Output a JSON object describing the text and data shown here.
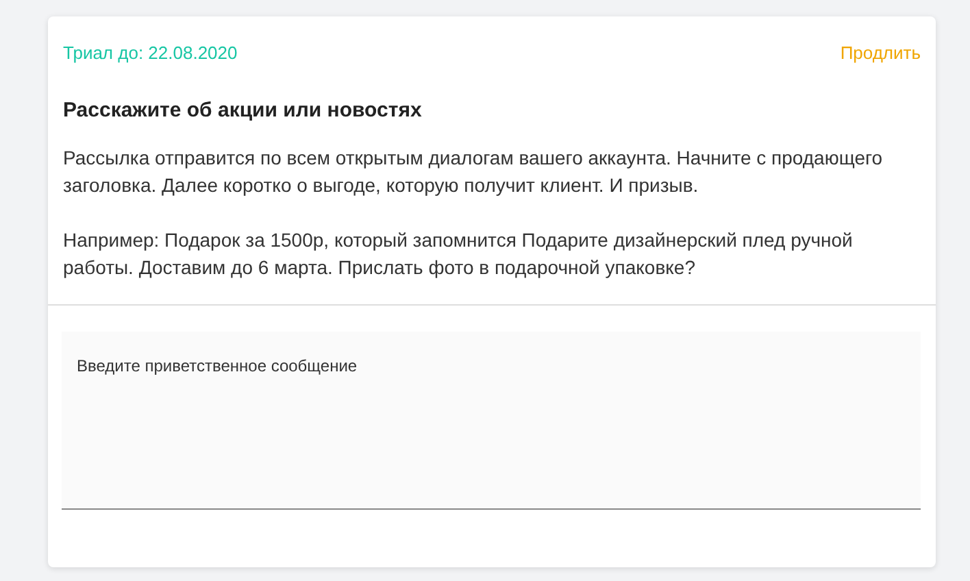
{
  "trial": {
    "label": "Триал до: 22.08.2020",
    "action": "Продлить"
  },
  "title": "Расскажите об акции или новостях",
  "paragraphs": [
    "Рассылка отправится по всем открытым диалогам вашего аккаунта. Начните с продающего заголовка. Далее коротко о выгоде, которую получит клиент. И призыв.",
    "Например: Подарок за 1500р, который запомнится Подарите дизайнерский плед ручной работы. Доставим до 6 марта. Прислать фото в подарочной упаковке?"
  ],
  "message": {
    "placeholder": "Введите приветственное сообщение"
  }
}
